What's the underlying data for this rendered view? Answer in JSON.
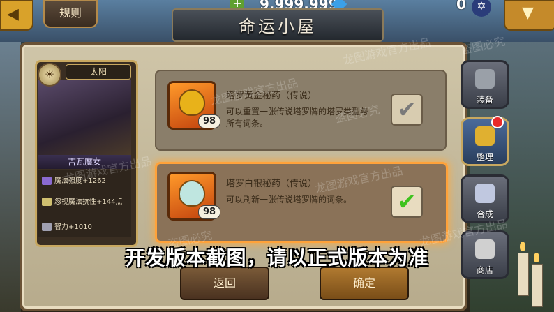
{
  "top_bar": {
    "rules_label": "规则",
    "gold_amount": "9,999,999",
    "star_amount": "0"
  },
  "title": "命运小屋",
  "card": {
    "type_label": "太阳",
    "card_name": "吉瓦魔女",
    "stats": [
      {
        "text": "魔法强度+1262",
        "icon": "magic-power-icon"
      },
      {
        "text": "忽视魔法抗性+144点",
        "icon": "magic-penetration-icon"
      },
      {
        "text": "智力+1010",
        "icon": "intelligence-icon"
      }
    ]
  },
  "items": [
    {
      "name": "塔罗黄金秘药（传说）",
      "desc": "可以重置一张传说塔罗牌的塔罗类型与所有词条。",
      "count": "98",
      "selected": false,
      "color": "#e8b21a"
    },
    {
      "name": "塔罗白银秘药（传说）",
      "desc": "可以刷新一张传说塔罗牌的词条。",
      "count": "98",
      "selected": true,
      "color": "#bfe6e0"
    }
  ],
  "buttons": {
    "back": "返回",
    "confirm": "确定"
  },
  "side_tabs": [
    {
      "label": "装备",
      "icon": "helmet-icon",
      "active": false
    },
    {
      "label": "整理",
      "icon": "cards-stack-icon",
      "active": true,
      "notification": true
    },
    {
      "label": "合成",
      "icon": "star-card-icon",
      "active": false
    },
    {
      "label": "商店",
      "icon": "shop-icon",
      "active": false
    }
  ],
  "watermark": [
    "龙图游戏官方出品",
    "盗图必究"
  ],
  "dev_notice": "开发版本截图，请以正式版本为准"
}
